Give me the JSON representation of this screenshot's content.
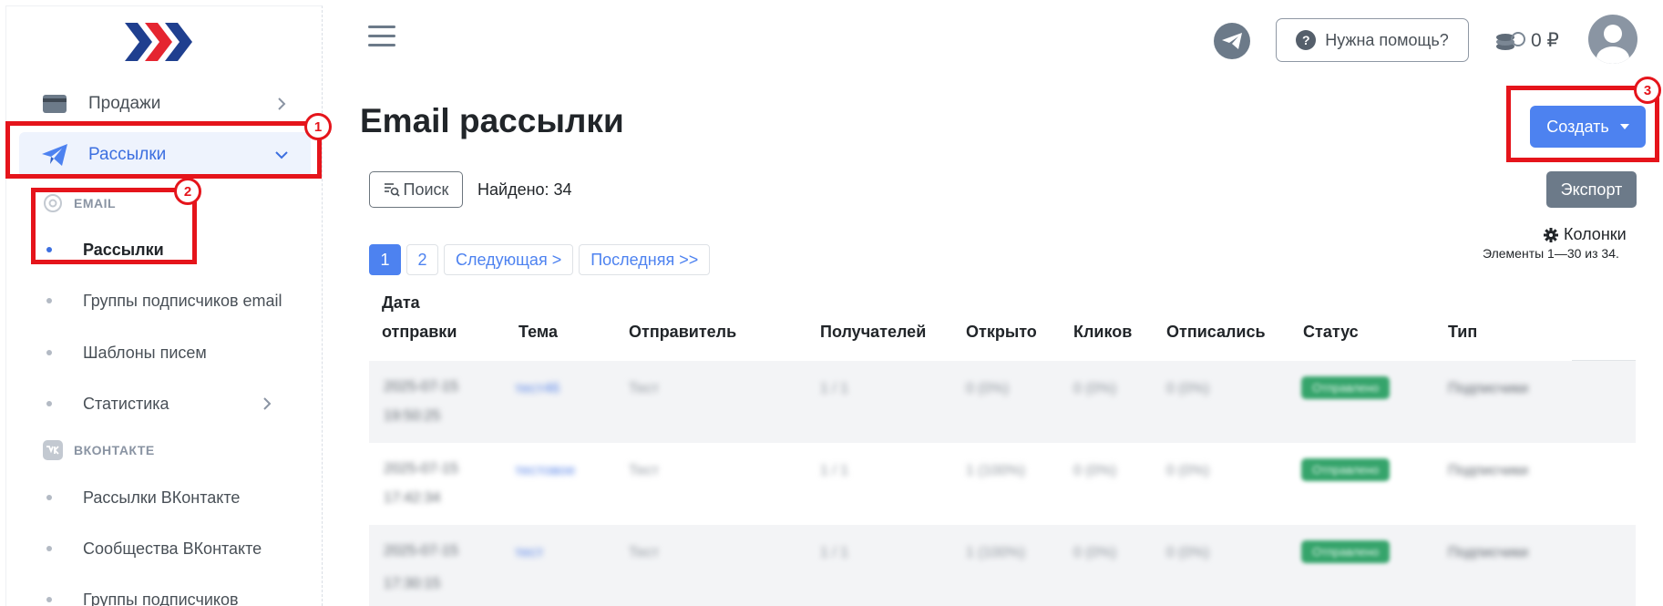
{
  "sidebar": {
    "menu": [
      {
        "label": "Продажи",
        "icon": "card-icon"
      },
      {
        "label": "Рассылки",
        "icon": "paper-plane-icon"
      }
    ],
    "sections": [
      {
        "title": "EMAIL",
        "icon": "at-sign-icon"
      },
      {
        "title": "ВКОНТАКТЕ",
        "icon": "vk-icon"
      }
    ],
    "email_items": [
      {
        "label": "Рассылки"
      },
      {
        "label": "Группы подписчиков email"
      },
      {
        "label": "Шаблоны писем"
      },
      {
        "label": "Статистика"
      }
    ],
    "vk_items": [
      {
        "label": "Рассылки ВКонтакте"
      },
      {
        "label": "Сообщества ВКонтакте"
      },
      {
        "label": "Группы подписчиков"
      }
    ]
  },
  "header": {
    "help_label": "Нужна помощь?",
    "help_q": "?",
    "balance": "0 ₽"
  },
  "main": {
    "title": "Email рассылки",
    "create_label": "Создать",
    "export_label": "Экспорт",
    "search_label": "Поиск",
    "found_label": "Найдено: 34",
    "columns_label": "Колонки",
    "elements_info": "Элементы 1—30 из 34.",
    "pager": {
      "pages": [
        "1",
        "2"
      ],
      "next": "Следующая >",
      "last": "Последняя >>"
    }
  },
  "table": {
    "headers": {
      "date_line1": "Дата",
      "date_line2": "отправки",
      "subject": "Тема",
      "sender": "Отправитель",
      "recipients": "Получателей",
      "opened": "Открыто",
      "clicks": "Кликов",
      "unsubscribed": "Отписались",
      "status": "Статус",
      "type": "Тип"
    },
    "rows": [
      {
        "date1": "2025-07-15",
        "date2": "19:50:25",
        "subject": "тест46",
        "sender": "Тест",
        "recipients": "1 / 1",
        "opened": "0 (0%)",
        "clicks": "0 (0%)",
        "unsub": "0 (0%)",
        "status": "Отправлено",
        "type": "Подписчики"
      },
      {
        "date1": "2025-07-15",
        "date2": "17:42:34",
        "subject": "тестовое",
        "sender": "Тест",
        "recipients": "1 / 1",
        "opened": "1 (100%)",
        "clicks": "0 (0%)",
        "unsub": "0 (0%)",
        "status": "Отправлено",
        "type": "Подписчики"
      },
      {
        "date1": "2025-07-15",
        "date2": "17:30:15",
        "subject": "тест",
        "sender": "Тест",
        "recipients": "1 / 1",
        "opened": "1 (100%)",
        "clicks": "0 (0%)",
        "unsub": "0 (0%)",
        "status": "Отправлено",
        "type": "Подписчики"
      }
    ]
  },
  "annotations": [
    "1",
    "2",
    "3"
  ],
  "colors": {
    "accent": "#4d82f0",
    "annotation": "#e5141b",
    "status_green": "#35a46b"
  }
}
